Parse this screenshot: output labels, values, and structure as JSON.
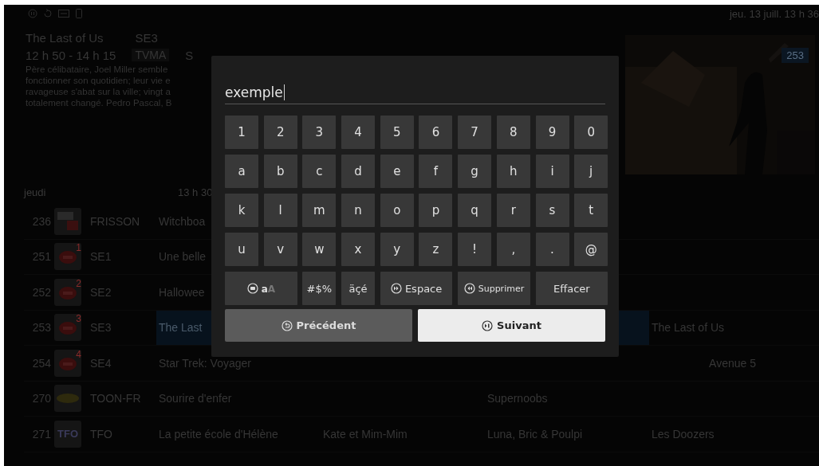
{
  "status_bar": {
    "datetime": "jeu. 13 juill. 13 h 36"
  },
  "info": {
    "title": "The Last of Us",
    "channel": "SE3",
    "time": "12 h 50 - 14 h 15",
    "rating": "TVMA",
    "extra": "S",
    "description_lines": [
      "Père célibataire, Joel Miller semble",
      "fonctionner son quotidien; leur vie e",
      "ravageuse s'abat sur la ville; vingt a",
      "totalement changé. Pedro Pascal, B"
    ]
  },
  "preview": {
    "kind": "picture",
    "channel_badge": "253"
  },
  "guide": {
    "day": "jeudi",
    "time_header": "13 h 30",
    "rows": [
      {
        "number": "236",
        "kind": "frisson",
        "name": "FRISSON",
        "programs": [
          {
            "title": "Witchboa",
            "selected": false
          }
        ]
      },
      {
        "number": "251",
        "kind": "se",
        "logo_text": "1",
        "name": "SE1",
        "programs": [
          {
            "title": "Une belle",
            "selected": false
          }
        ]
      },
      {
        "number": "252",
        "kind": "se",
        "logo_text": "2",
        "name": "SE2",
        "programs": [
          {
            "title": "Hallowee",
            "selected": false
          }
        ]
      },
      {
        "number": "253",
        "kind": "se",
        "logo_text": "3",
        "name": "SE3",
        "programs": [
          {
            "title": "The Last",
            "selected": true
          },
          {
            "title": "The Last of Us",
            "selected": false
          }
        ]
      },
      {
        "number": "254",
        "kind": "se",
        "logo_text": "4",
        "name": "SE4",
        "programs": [
          {
            "title": "Star Trek: Voyager",
            "selected": false
          },
          {
            "title": "Avenue 5",
            "selected": false
          }
        ]
      },
      {
        "number": "270",
        "kind": "toon",
        "name": "TOON-FR",
        "programs": [
          {
            "title": "Sourire d'enfer",
            "selected": false
          },
          {
            "title": "Supernoobs",
            "selected": false
          }
        ]
      },
      {
        "number": "271",
        "kind": "tfo",
        "logo_text": "TFO",
        "name": "TFO",
        "programs": [
          {
            "title": "La petite école d'Hélène",
            "selected": false
          },
          {
            "title": "Kate et Mim-Mim",
            "selected": false
          },
          {
            "title": "Luna, Bric & Poulpi",
            "selected": false
          },
          {
            "title": "Les Doozers",
            "selected": false
          }
        ]
      }
    ]
  },
  "keyboard": {
    "value": "exemple",
    "rows": [
      [
        "1",
        "2",
        "3",
        "4",
        "5",
        "6",
        "7",
        "8",
        "9",
        "0"
      ],
      [
        "a",
        "b",
        "c",
        "d",
        "e",
        "f",
        "g",
        "h",
        "i",
        "j"
      ],
      [
        "k",
        "l",
        "m",
        "n",
        "o",
        "p",
        "q",
        "r",
        "s",
        "t"
      ],
      [
        "u",
        "v",
        "w",
        "x",
        "y",
        "z",
        "!",
        ",",
        ".",
        "@"
      ]
    ],
    "function_keys": [
      {
        "kind": "case",
        "lower": "a",
        "upper": "A",
        "uppercase": false
      },
      {
        "kind": "plain",
        "label": "#$%"
      },
      {
        "kind": "plain",
        "label": "äçé"
      },
      {
        "kind": "forward",
        "label": "Espace"
      },
      {
        "kind": "back",
        "label": "Supprimer"
      },
      {
        "kind": "wide",
        "label": "Effacer"
      }
    ],
    "buttons": [
      {
        "label": "Précédent",
        "selected": false
      },
      {
        "label": "Suivant",
        "selected": true
      }
    ]
  }
}
